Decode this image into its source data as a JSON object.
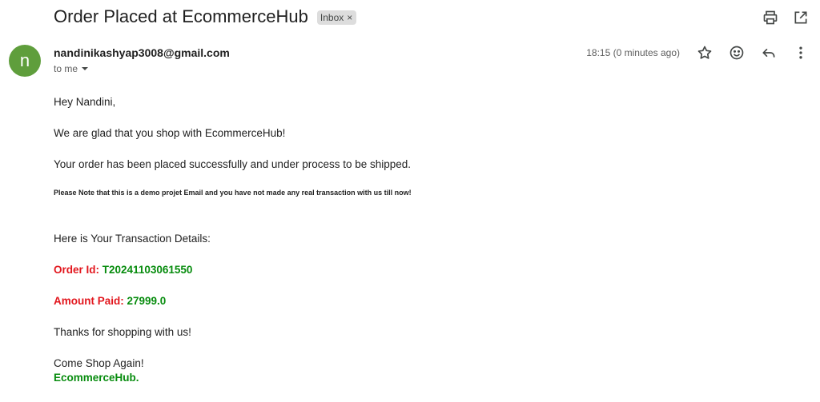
{
  "email": {
    "subject": "Order Placed at EcommerceHub",
    "label": "Inbox",
    "label_close": "×",
    "avatar_letter": "n",
    "sender": "nandinikashyap3008@gmail.com",
    "recipient": "to me",
    "timestamp": "18:15 (0 minutes ago)"
  },
  "body": {
    "greeting": "Hey Nandini,",
    "line1": "We are glad that you shop with EcommerceHub!",
    "line2": "Your order has been placed successfully and under process to be shipped.",
    "note": "Please Note that this is a demo projet Email and you have not made any real transaction with us till now!",
    "details_intro": "Here is Your Transaction Details:",
    "order_label": "Order Id:",
    "order_value": "T20241103061550",
    "amount_label": "Amount Paid:",
    "amount_value": "27999.0",
    "thanks": "Thanks for shopping with us!",
    "come_again": "Come Shop Again!",
    "signature": "EcommerceHub."
  },
  "icons": {
    "print": "print-icon",
    "open_new": "open-in-new-window-icon",
    "star": "star-icon",
    "emoji": "emoji-reaction-icon",
    "reply": "reply-icon",
    "more": "more-options-icon"
  },
  "colors": {
    "avatar": "#5f9e3c",
    "label_red": "#e2161d",
    "value_green": "#078c0e"
  }
}
